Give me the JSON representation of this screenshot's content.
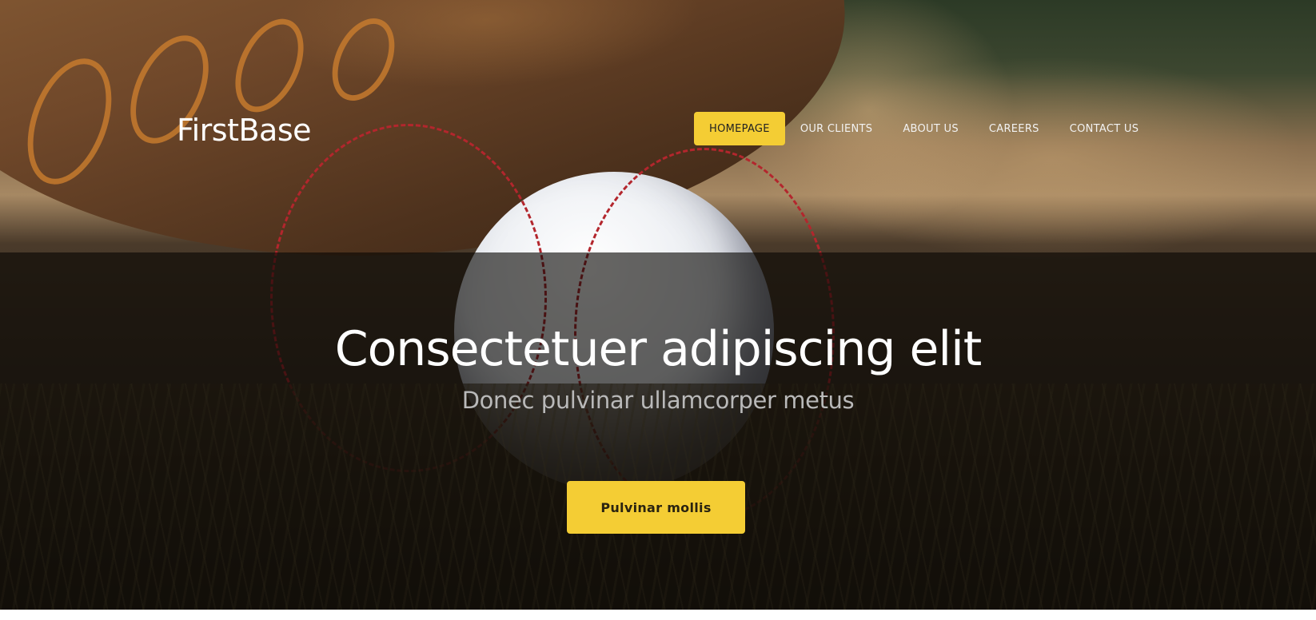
{
  "brand": {
    "logo_text": "FirstBase"
  },
  "nav": {
    "items": [
      {
        "label": "HOMEPAGE",
        "active": true
      },
      {
        "label": "OUR CLIENTS",
        "active": false
      },
      {
        "label": "ABOUT US",
        "active": false
      },
      {
        "label": "CAREERS",
        "active": false
      },
      {
        "label": "CONTACT US",
        "active": false
      }
    ]
  },
  "hero": {
    "title": "Consectetuer adipiscing elit",
    "subtitle": "Donec pulvinar ullamcorper metus",
    "cta_label": "Pulvinar mollis",
    "background_image": "baseball-in-glove-photo"
  },
  "colors": {
    "accent": "#f4cd34",
    "title": "#ffffff",
    "subtitle": "#b9b9b9",
    "overlay": "#080604"
  }
}
